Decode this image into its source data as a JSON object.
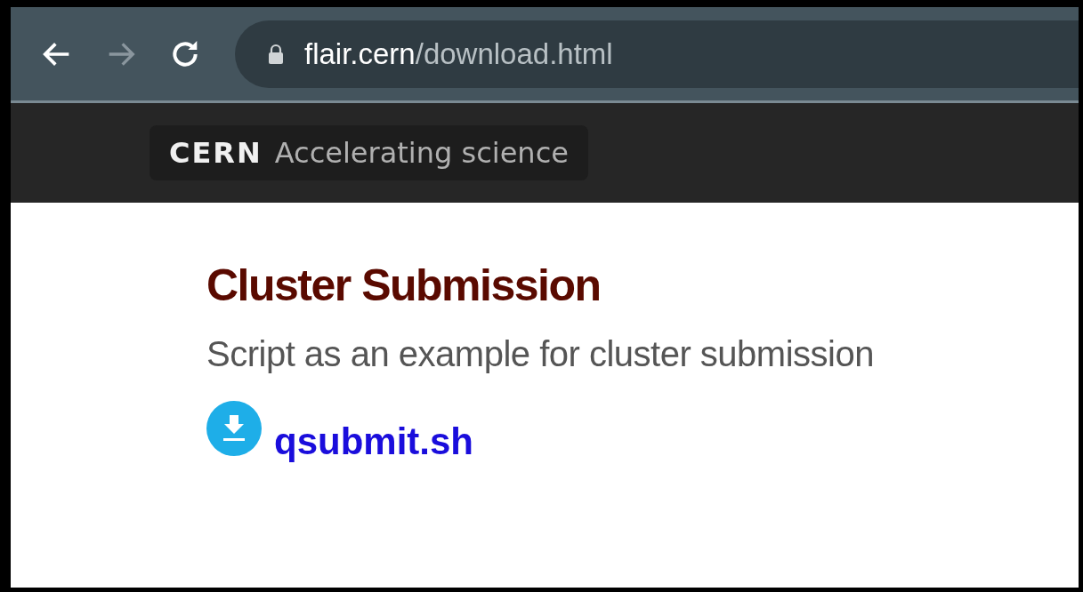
{
  "browser": {
    "url_host": "flair.cern",
    "url_path": "/download.html",
    "forward_disabled": true
  },
  "banner": {
    "brand": "CERN",
    "tagline": "Accelerating science"
  },
  "section": {
    "title": "Cluster Submission",
    "description": "Script as an example for cluster submission",
    "download_link": "qsubmit.sh"
  }
}
